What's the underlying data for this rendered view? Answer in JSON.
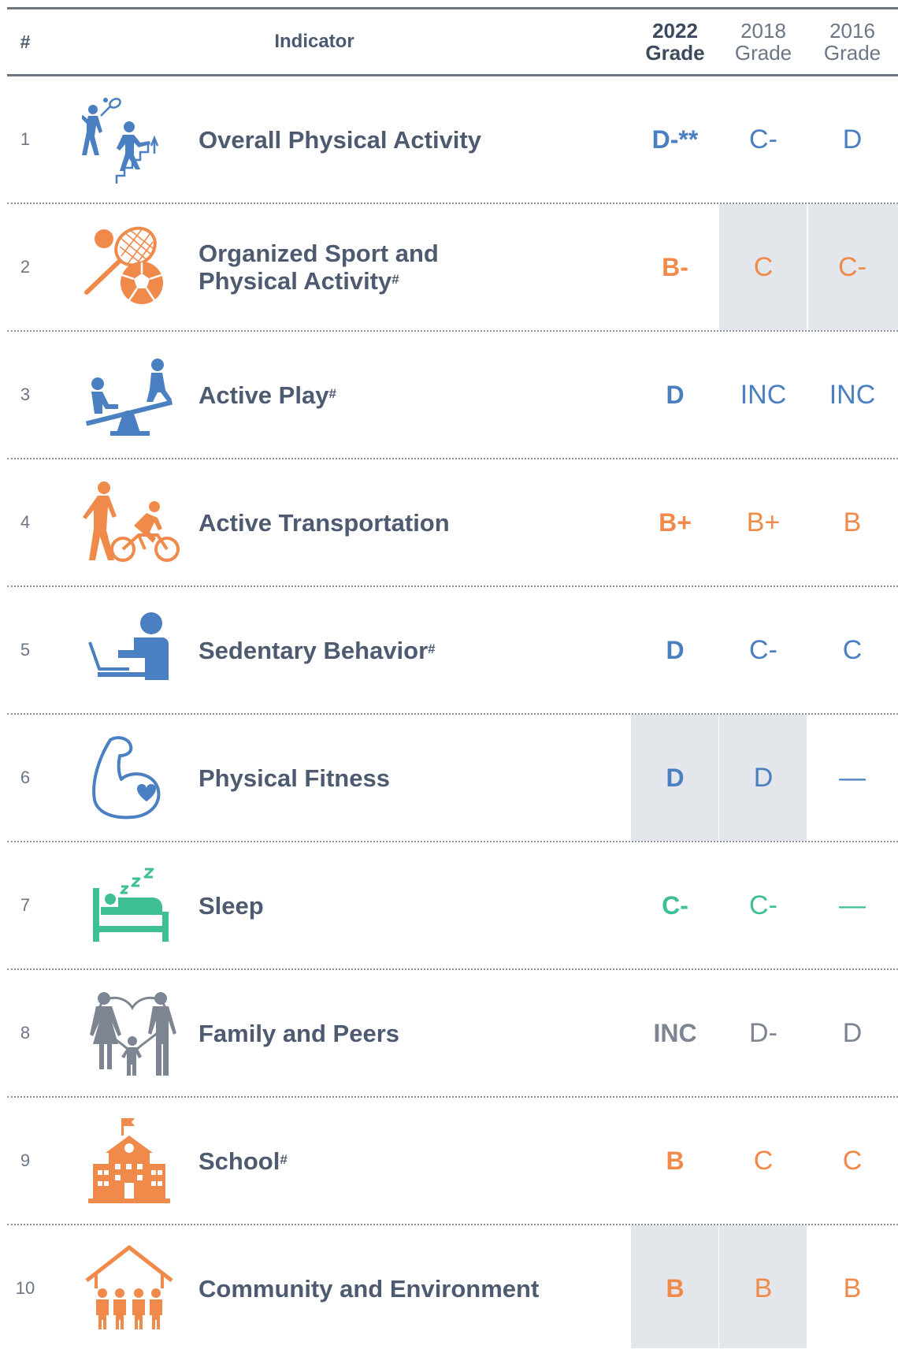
{
  "header": {
    "num": "#",
    "indicator": "Indicator",
    "g2022_year": "2022",
    "g2022_label": "Grade",
    "g2018_year": "2018",
    "g2018_label": "Grade",
    "g2016_year": "2016",
    "g2016_label": "Grade"
  },
  "colors": {
    "blue": "#4a7fc1",
    "orange": "#f08a4b",
    "green": "#3fbf95",
    "gray": "#7c8591",
    "shade": "#e3e6ea"
  },
  "rows": [
    {
      "num": "1",
      "label": "Overall Physical Activity",
      "sup": "",
      "icon": "sports-activity-icon",
      "g2022": "D-**",
      "g2018": "C-",
      "g2016": "D"
    },
    {
      "num": "2",
      "label": "Organized Sport and",
      "label2": "Physical Activity",
      "sup": "#",
      "icon": "racket-ball-icon",
      "g2022": "B-",
      "g2018": "C",
      "g2016": "C-"
    },
    {
      "num": "3",
      "label": "Active Play",
      "sup": "#",
      "icon": "seesaw-icon",
      "g2022": "D",
      "g2018": "INC",
      "g2016": "INC"
    },
    {
      "num": "4",
      "label": "Active Transportation",
      "sup": "",
      "icon": "walk-bike-icon",
      "g2022": "B+",
      "g2018": "B+",
      "g2016": "B"
    },
    {
      "num": "5",
      "label": "Sedentary Behavior",
      "sup": "#",
      "icon": "laptop-person-icon",
      "g2022": "D",
      "g2018": "C-",
      "g2016": "C"
    },
    {
      "num": "6",
      "label": "Physical Fitness",
      "sup": "",
      "icon": "muscle-heart-icon",
      "g2022": "D",
      "g2018": "D",
      "g2016": "—"
    },
    {
      "num": "7",
      "label": "Sleep",
      "sup": "",
      "icon": "sleep-bed-icon",
      "g2022": "C-",
      "g2018": "C-",
      "g2016": "—"
    },
    {
      "num": "8",
      "label": "Family and Peers",
      "sup": "",
      "icon": "family-icon",
      "g2022": "INC",
      "g2018": "D-",
      "g2016": "D"
    },
    {
      "num": "9",
      "label": "School",
      "sup": "#",
      "icon": "school-icon",
      "g2022": "B",
      "g2018": "C",
      "g2016": "C"
    },
    {
      "num": "10",
      "label": "Community and Environment",
      "sup": "",
      "icon": "community-icon",
      "g2022": "B",
      "g2018": "B",
      "g2016": "B"
    }
  ]
}
